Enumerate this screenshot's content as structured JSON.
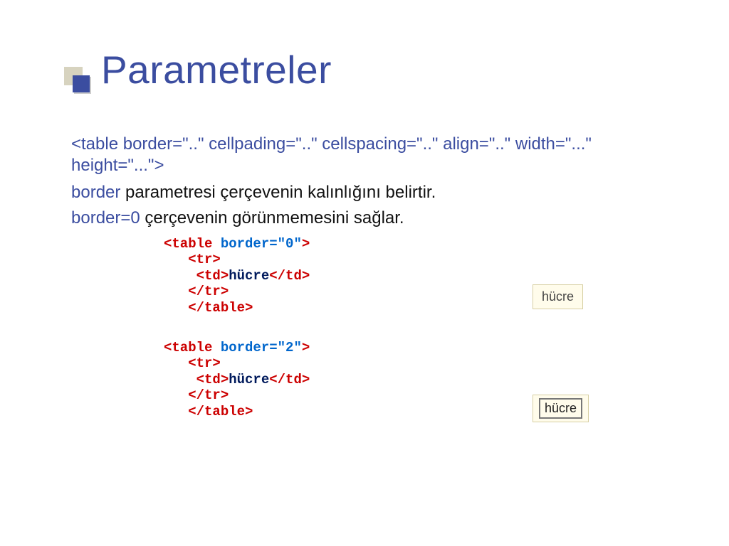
{
  "title": "Parametreler",
  "syntax_line": "<table border=\"..\" cellpading=\"..\" cellspacing=\"..\" align=\"..\" width=\"...\"    height=\"...\">",
  "line_border": {
    "kw": "border",
    "rest": " parametresi çerçevenin kalınlığını belirtir."
  },
  "line_border0": {
    "kw": "border=0",
    "rest": " çerçevenin görünmemesini  sağlar."
  },
  "code1": {
    "open_tag_start": "<table ",
    "open_tag_attr": "border=\"0\"",
    "open_tag_end": ">",
    "tr_open": "   <tr>",
    "td_open": "    <td>",
    "cell_text": "hücre",
    "td_close": "</td>",
    "tr_close": "   </tr>",
    "tbl_close": "   </table>"
  },
  "code2": {
    "open_tag_start": "<table ",
    "open_tag_attr": "border=\"2\"",
    "open_tag_end": ">",
    "tr_open": "   <tr>",
    "td_open": "    <td>",
    "cell_text": "hücre",
    "td_close": "</td>",
    "tr_close": "   </tr>",
    "tbl_close": "   </table>"
  },
  "preview1_text": "hücre",
  "preview2_text": "hücre"
}
